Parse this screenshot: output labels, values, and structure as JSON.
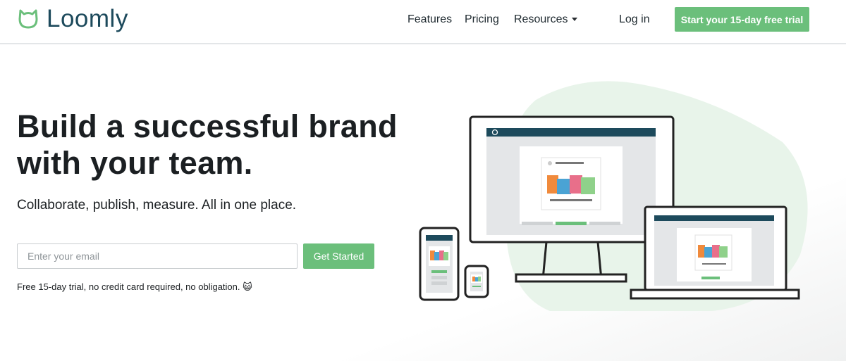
{
  "header": {
    "brand": "Loomly",
    "nav": {
      "features": "Features",
      "pricing": "Pricing",
      "resources": "Resources",
      "login": "Log in"
    },
    "cta": "Start your 15-day free trial"
  },
  "hero": {
    "title_line1": "Build a successful brand",
    "title_line2": "with your team.",
    "subtitle": "Collaborate, publish, measure. All in one place.",
    "email_placeholder": "Enter your email",
    "button": "Get Started",
    "fineprint": "Free 15-day trial, no credit card required, no obligation. 😺"
  },
  "colors": {
    "brand_green": "#6bbf7b",
    "brand_navy": "#1d4a5c",
    "blob_green": "#e8f4ea"
  }
}
